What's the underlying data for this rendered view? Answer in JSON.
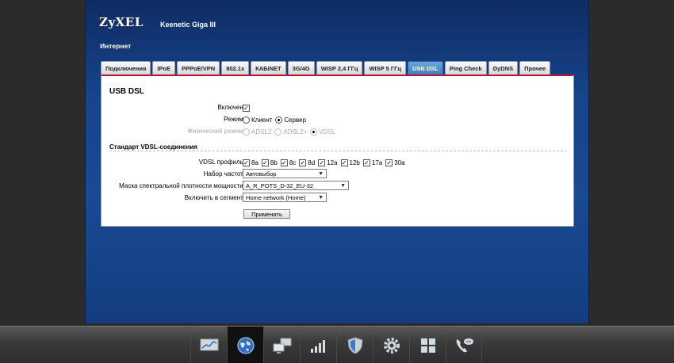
{
  "brand": {
    "logo": "ZyXEL",
    "model": "Keenetic Giga III"
  },
  "section_title": "Интернет",
  "tabs": [
    {
      "label": "Подключения",
      "active": false
    },
    {
      "label": "IPoE",
      "active": false
    },
    {
      "label": "PPPoE/VPN",
      "active": false
    },
    {
      "label": "802.1x",
      "active": false
    },
    {
      "label": "КАБiNET",
      "active": false
    },
    {
      "label": "3G/4G",
      "active": false
    },
    {
      "label": "WISP 2,4 ГГц",
      "active": false
    },
    {
      "label": "WISP 5 ГГц",
      "active": false
    },
    {
      "label": "USB DSL",
      "active": true
    },
    {
      "label": "Ping Check",
      "active": false
    },
    {
      "label": "DyDNS",
      "active": false
    },
    {
      "label": "Прочее",
      "active": false
    }
  ],
  "panel": {
    "title": "USB DSL",
    "enabled": {
      "label": "Включен:",
      "checked": true
    },
    "mode": {
      "label": "Режим:",
      "options": [
        "Клиент",
        "Сервер"
      ],
      "selected": "Сервер"
    },
    "phys_mode": {
      "label": "Физический режим:",
      "options": [
        "ADSL2",
        "ADSL2+",
        "VDSL"
      ],
      "selected": "VDSL"
    },
    "vdsl_heading": "Стандарт VDSL-соединения",
    "vdsl_profile": {
      "label": "VDSL профиль:",
      "profiles": [
        "8a",
        "8b",
        "8c",
        "8d",
        "12a",
        "12b",
        "17a",
        "30a"
      ]
    },
    "freq_set": {
      "label": "Набор частот:",
      "value": "Автовыбор"
    },
    "psd_mask": {
      "label": "Маска спектральной плотности мощности:",
      "value": "A_R_POTS_D-32_EU-32"
    },
    "segment": {
      "label": "Включить в сегмент:",
      "value": "Home network (Home)"
    },
    "apply_label": "Применить"
  },
  "dock": [
    {
      "icon": "monitor-chart-icon",
      "active": false
    },
    {
      "icon": "globe-icon",
      "active": true
    },
    {
      "icon": "network-computers-icon",
      "active": false
    },
    {
      "icon": "signal-bars-icon",
      "active": false
    },
    {
      "icon": "shield-icon",
      "active": false
    },
    {
      "icon": "gear-icon",
      "active": false
    },
    {
      "icon": "apps-grid-icon",
      "active": false
    },
    {
      "icon": "phone-chat-icon",
      "active": false
    }
  ]
}
